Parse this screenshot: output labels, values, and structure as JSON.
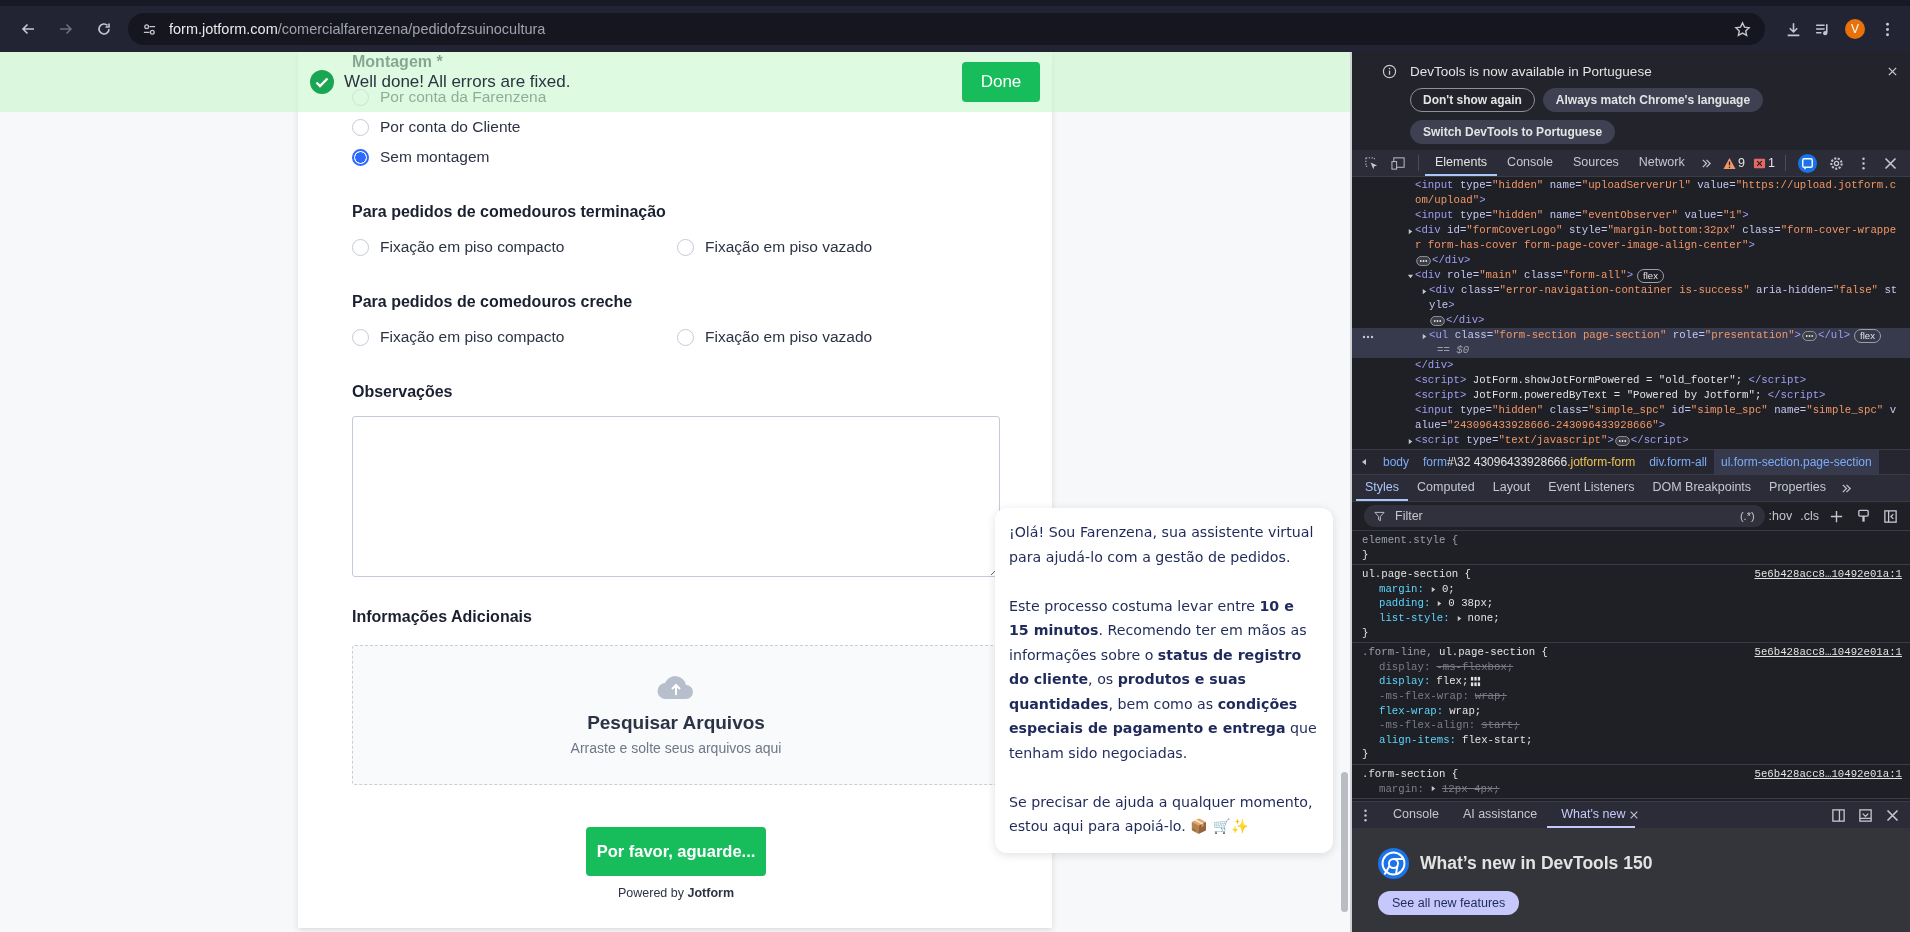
{
  "browser": {
    "url_host": "form.jotform.com",
    "url_path": "/comercialfarenzena/pedidofzsuinocultura",
    "profile_initial": "V"
  },
  "success_banner": {
    "message": "Well done! All errors are fixed.",
    "button": "Done"
  },
  "form": {
    "sections": [
      {
        "kind": "radio-list",
        "title": "Montagem *",
        "options": [
          {
            "label": "Por conta da Farenzena",
            "selected": false
          },
          {
            "label": "Por conta do Cliente",
            "selected": false
          },
          {
            "label": "Sem montagem",
            "selected": true
          }
        ]
      },
      {
        "kind": "radio-grid",
        "title": "Para pedidos de comedouros terminação",
        "options": [
          {
            "label": "Fixação em piso compacto",
            "selected": false
          },
          {
            "label": "Fixação em piso vazado",
            "selected": false
          }
        ]
      },
      {
        "kind": "radio-grid",
        "title": "Para pedidos de comedouros creche",
        "options": [
          {
            "label": "Fixação em piso compacto",
            "selected": false
          },
          {
            "label": "Fixação em piso vazado",
            "selected": false
          }
        ]
      },
      {
        "kind": "textarea",
        "title": "Observações"
      },
      {
        "kind": "upload",
        "title": "Informações Adicionais",
        "upload_title": "Pesquisar Arquivos",
        "upload_hint": "Arraste e solte seus arquivos aqui"
      }
    ],
    "submit": "Por favor, aguarde...",
    "powered_by": "Powered by **Jotform**"
  },
  "assistant_message": {
    "paragraphs": [
      "¡Olá! Sou Farenzena, sua assistente virtual para ajudá-lo com a gestão de pedidos.",
      "Este processo costuma levar entre **10 e 15 minutos**. Recomendo ter em mãos as informações sobre o **status de registro do cliente**, os **produtos e suas quantidades**, bem como as **condições especiais de pagamento e entrega** que tenham sido negociadas.",
      "Se precisar de ajuda a qualquer momento, estou aqui para apoiá-lo. 📦 🛒✨"
    ]
  },
  "devtools": {
    "notice": {
      "text": "DevTools is now available in Portuguese",
      "buttons": [
        {
          "label": "Don't show again",
          "kind": "outline"
        },
        {
          "label": "Always match Chrome's language",
          "kind": "filled"
        },
        {
          "label": "Switch DevTools to Portuguese",
          "kind": "filled"
        }
      ]
    },
    "main_tabs": [
      {
        "label": "Elements",
        "selected": true
      },
      {
        "label": "Console",
        "selected": false
      },
      {
        "label": "Sources",
        "selected": false
      },
      {
        "label": "Network",
        "selected": false
      }
    ],
    "warnings": "9",
    "errors": "1",
    "dom_nodes": [
      {
        "selected": false,
        "tokens": [
          {
            "kind": "tag",
            "text": "<input"
          },
          {
            "kind": "attr",
            "text": " type="
          },
          {
            "kind": "value",
            "text": "\"hidden\""
          },
          {
            "kind": "attr",
            "text": " name="
          },
          {
            "kind": "value",
            "text": "\"uploadServerUrl\""
          },
          {
            "kind": "attr",
            "text": " value="
          },
          {
            "kind": "value",
            "text": "\"https://upload.jotform.com/upload\""
          },
          {
            "kind": "tag",
            "text": ">"
          }
        ]
      },
      {
        "selected": false,
        "tokens": [
          {
            "kind": "tag",
            "text": "<input"
          },
          {
            "kind": "attr",
            "text": " type="
          },
          {
            "kind": "value",
            "text": "\"hidden\""
          },
          {
            "kind": "attr",
            "text": " name="
          },
          {
            "kind": "value",
            "text": "\"eventObserver\""
          },
          {
            "kind": "attr",
            "text": " value="
          },
          {
            "kind": "value",
            "text": "\"1\""
          },
          {
            "kind": "tag",
            "text": ">"
          }
        ]
      },
      {
        "expanded": false,
        "selected": false,
        "tokens": [
          {
            "kind": "tag",
            "text": "<div"
          },
          {
            "kind": "attr",
            "text": " id="
          },
          {
            "kind": "value",
            "text": "\"formCoverLogo\""
          },
          {
            "kind": "attr",
            "text": " style="
          },
          {
            "kind": "value",
            "text": "\"margin-bottom:32px\""
          },
          {
            "kind": "attr",
            "text": " class="
          },
          {
            "kind": "value",
            "text": "\"form-cover-wrapper form-has-cover form-page-cover-image-align-center\""
          },
          {
            "kind": "tag",
            "text": ">"
          },
          {
            "kind": "collapsed"
          },
          {
            "kind": "tag",
            "text": "</div>"
          }
        ]
      },
      {
        "expanded": true,
        "selected": false,
        "tokens": [
          {
            "kind": "tag",
            "text": "<div"
          },
          {
            "kind": "attr",
            "text": " role="
          },
          {
            "kind": "value",
            "text": "\"main\""
          },
          {
            "kind": "attr",
            "text": " class="
          },
          {
            "kind": "value",
            "text": "\"form-all\""
          },
          {
            "kind": "tag",
            "text": ">"
          },
          {
            "kind": "badge",
            "text": "flex"
          }
        ],
        "children": [
          {
            "expanded": false,
            "selected": false,
            "tokens": [
              {
                "kind": "tag",
                "text": "<div"
              },
              {
                "kind": "attr",
                "text": " class="
              },
              {
                "kind": "value",
                "text": "\"error-navigation-container is-success\""
              },
              {
                "kind": "attr",
                "text": " aria-hidden="
              },
              {
                "kind": "value",
                "text": "\"false\""
              },
              {
                "kind": "attr",
                "text": " style"
              },
              {
                "kind": "tag",
                "text": ">"
              },
              {
                "kind": "collapsed"
              },
              {
                "kind": "tag",
                "text": "</div>"
              }
            ]
          },
          {
            "expanded": false,
            "selected": true,
            "tokens": [
              {
                "kind": "tag",
                "text": "<ul"
              },
              {
                "kind": "attr",
                "text": " class="
              },
              {
                "kind": "value",
                "text": "\"form-section page-section\""
              },
              {
                "kind": "attr",
                "text": " role="
              },
              {
                "kind": "value",
                "text": "\"presentation\""
              },
              {
                "kind": "tag",
                "text": ">"
              },
              {
                "kind": "collapsed"
              },
              {
                "kind": "tag",
                "text": "</ul>"
              },
              {
                "kind": "badge",
                "text": "flex"
              },
              {
                "kind": "marker",
                "text": "== $0"
              }
            ]
          }
        ]
      },
      {
        "selected": false,
        "tokens": [
          {
            "kind": "tag",
            "text": "</div>"
          }
        ]
      },
      {
        "selected": false,
        "tokens": [
          {
            "kind": "tag",
            "text": "<script>"
          },
          {
            "kind": "text",
            "text": " JotForm.showJotFormPowered = \"old_footer\"; "
          },
          {
            "kind": "tag",
            "text": "</script>"
          }
        ]
      },
      {
        "selected": false,
        "tokens": [
          {
            "kind": "tag",
            "text": "<script>"
          },
          {
            "kind": "text",
            "text": " JotForm.poweredByText = \"Powered by Jotform\"; "
          },
          {
            "kind": "tag",
            "text": "</script>"
          }
        ]
      },
      {
        "selected": false,
        "tokens": [
          {
            "kind": "tag",
            "text": "<input"
          },
          {
            "kind": "attr",
            "text": " type="
          },
          {
            "kind": "value",
            "text": "\"hidden\""
          },
          {
            "kind": "attr",
            "text": " class="
          },
          {
            "kind": "value",
            "text": "\"simple_spc\""
          },
          {
            "kind": "attr",
            "text": " id="
          },
          {
            "kind": "value",
            "text": "\"simple_spc\""
          },
          {
            "kind": "attr",
            "text": " name="
          },
          {
            "kind": "value",
            "text": "\"simple_spc\""
          },
          {
            "kind": "attr",
            "text": " value="
          },
          {
            "kind": "value",
            "text": "\"243096433928666-243096433928666\""
          },
          {
            "kind": "tag",
            "text": ">"
          }
        ]
      },
      {
        "expanded": false,
        "selected": false,
        "tokens": [
          {
            "kind": "tag",
            "text": "<script"
          },
          {
            "kind": "attr",
            "text": " type="
          },
          {
            "kind": "value",
            "text": "\"text/javascript\""
          },
          {
            "kind": "tag",
            "text": ">"
          },
          {
            "kind": "collapsed"
          },
          {
            "kind": "tag",
            "text": "</script>"
          }
        ]
      }
    ],
    "breadcrumbs": [
      {
        "selected": false,
        "parts": [
          {
            "kind": "tag",
            "text": "body"
          }
        ]
      },
      {
        "selected": false,
        "parts": [
          {
            "kind": "tag",
            "text": "form"
          },
          {
            "kind": "id",
            "text": "#\\32 43096433928666"
          },
          {
            "kind": "class",
            "text": ".jotform-form"
          }
        ]
      },
      {
        "selected": false,
        "parts": [
          {
            "kind": "tag",
            "text": "div.form-all"
          }
        ]
      },
      {
        "selected": true,
        "parts": [
          {
            "kind": "tag",
            "text": "ul.form-section.page-section"
          }
        ]
      }
    ],
    "style_tabs": [
      {
        "label": "Styles",
        "selected": true
      },
      {
        "label": "Computed",
        "selected": false
      },
      {
        "label": "Layout",
        "selected": false
      },
      {
        "label": "Event Listeners",
        "selected": false
      },
      {
        "label": "DOM Breakpoints",
        "selected": false
      },
      {
        "label": "Properties",
        "selected": false
      }
    ],
    "filter": {
      "placeholder": "Filter",
      "regex": "(.*)",
      "tools": [
        ":hov",
        ".cls"
      ]
    },
    "rules": [
      {
        "selector_parts": [
          {
            "text": "element.style {",
            "dim": true
          }
        ],
        "close": "}"
      },
      {
        "selector_parts": [
          {
            "text": "ul.page-section {",
            "dim": false
          }
        ],
        "source": "5e6b428acc8…10492e01a:1",
        "close": "}",
        "declarations": [
          {
            "property": "margin:",
            "value": "0;",
            "expandable": true,
            "overridden": false,
            "editor": false
          },
          {
            "property": "padding:",
            "value": "0 38px;",
            "expandable": true,
            "overridden": false,
            "editor": false
          },
          {
            "property": "list-style:",
            "value": "none;",
            "expandable": true,
            "overridden": false,
            "editor": false
          }
        ]
      },
      {
        "selector_parts": [
          {
            "text": ".form-line, ",
            "dim": true
          },
          {
            "text": "ul.page-section {",
            "dim": false
          }
        ],
        "source": "5e6b428acc8…10492e01a:1",
        "close": "}",
        "declarations": [
          {
            "property": "display:",
            "value": "-ms-flexbox;",
            "expandable": false,
            "overridden": true,
            "editor": false
          },
          {
            "property": "display:",
            "value": "flex;",
            "expandable": false,
            "overridden": false,
            "editor": true
          },
          {
            "property": "-ms-flex-wrap:",
            "value": "wrap;",
            "expandable": false,
            "overridden": true,
            "editor": false
          },
          {
            "property": "flex-wrap:",
            "value": "wrap;",
            "expandable": false,
            "overridden": false,
            "editor": false
          },
          {
            "property": "-ms-flex-align:",
            "value": "start;",
            "expandable": false,
            "overridden": true,
            "editor": false
          },
          {
            "property": "align-items:",
            "value": "flex-start;",
            "expandable": false,
            "overridden": false,
            "editor": false
          }
        ]
      },
      {
        "selector_parts": [
          {
            "text": ".form-section {",
            "dim": false
          }
        ],
        "source": "5e6b428acc8…10492e01a:1",
        "declarations": [
          {
            "property": "margin:",
            "value": "12px 4px;",
            "expandable": true,
            "overridden": true,
            "editor": false
          }
        ]
      }
    ],
    "drawer_tabs": [
      {
        "label": "Console",
        "selected": false,
        "closable": false
      },
      {
        "label": "AI assistance",
        "selected": false,
        "closable": false
      },
      {
        "label": "What's new",
        "selected": true,
        "closable": true
      }
    ],
    "whats_new": {
      "title": "What’s new in DevTools 150",
      "button": "See all new features"
    }
  }
}
